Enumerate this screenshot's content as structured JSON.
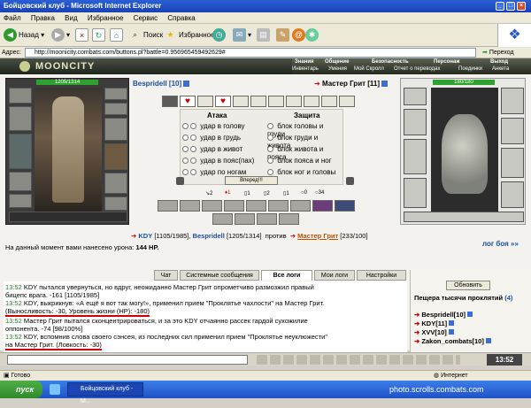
{
  "window": {
    "title": "Бойцовский клуб - Microsoft Internet Explorer"
  },
  "menu": [
    "Файл",
    "Правка",
    "Вид",
    "Избранное",
    "Сервис",
    "Справка"
  ],
  "toolbar": {
    "back": "Назад",
    "search": "Поиск",
    "favorites": "Избранное"
  },
  "address": {
    "label": "Адрес:",
    "url": "http://moonicity.combats.com/buttons.pl?battle=0.956965459492629#",
    "go": "Переход"
  },
  "game": {
    "logo": "MOONCITY",
    "nav_top": [
      "Знания",
      "Общение",
      "Безопасность",
      "Персонаж",
      "Выход"
    ],
    "nav_bottom": [
      "Инвентарь",
      "Умения",
      "Мой Скролл",
      "Отчет о переводах",
      "Поединки",
      "Анкета"
    ]
  },
  "player": {
    "hp": "1205/1314",
    "name": "Bespridell [10]"
  },
  "enemy": {
    "hp": "180/180",
    "name": "Мастер Грит [11]"
  },
  "combat": {
    "attack_header": "Атака",
    "defense_header": "Защита",
    "attacks": [
      "удар в голову",
      "удар в грудь",
      "удар в живот",
      "удар в пояс(пах)",
      "удар по ногам"
    ],
    "defenses": [
      "блок головы и груди",
      "блок груди и живота",
      "блок живота и пояса",
      "блок пояса и ног",
      "блок ног и головы"
    ],
    "fight_button": "Вперед!!!",
    "stats": [
      "2",
      "1",
      "1",
      "2",
      "1",
      "0",
      "34"
    ]
  },
  "summary": {
    "p1": "KDY",
    "p1_stats": "[1105/1985]",
    "p2": "Bespridell",
    "p2_stats": "[1205/1314]",
    "vs": "против",
    "enemy": "Мастер Грит",
    "enemy_stats": "[233/100]",
    "damage_label": "На данный момент вами нанесено урона:",
    "damage_value": "144 HP.",
    "log_link": "лог боя »»"
  },
  "tabs": [
    "Чат",
    "Системные сообщения",
    "Все логи",
    "Мои логи",
    "Настройки"
  ],
  "active_tab": "Все логи",
  "log": [
    {
      "t": "13:52",
      "text": "KDY пытался увернуться, но вдруг, неожиданно Мастер Грит опрометчиво размозжил правый"
    },
    {
      "t": "",
      "text": "бицепс врага. -161 [1105/1985]"
    },
    {
      "t": "13:52",
      "text": "KDY, выкрикнув: «А ещё я вот так могу!», применил прием \"Проклятье чахлости\" на Мастер Грит."
    },
    {
      "t": "",
      "text": "(Выносливость: -30, Уровень жизни (HP): -180)"
    },
    {
      "t": "13:52",
      "text": "Мастер Грит пытался сконцентрироваться, и за это KDY отчаянно рассек гардой сухожилие"
    },
    {
      "t": "",
      "text": "оппонента. -74 [98/100%]"
    },
    {
      "t": "13:52",
      "text": "KDY, вспомнив слова своего сэнсея, из последних сил применил прием \"Проклятье неуклюжести\""
    },
    {
      "t": "",
      "text": "на Мастер Грит. (Ловкость: -30)"
    }
  ],
  "side": {
    "refresh": "Обновить",
    "room": "Пещера тысячи проклятий",
    "count": "(4)",
    "users": [
      "Bespridell[10]",
      "KDY[11]",
      "XVV[10]",
      "Zakon_combats[10]"
    ]
  },
  "clock": "13:52",
  "status": {
    "ready": "Готово",
    "zone": "Интернет"
  },
  "taskbar": {
    "start": "пуск",
    "task": "Бойцовский клуб - M...",
    "watermark": "photo.scrolls.combats.com"
  }
}
